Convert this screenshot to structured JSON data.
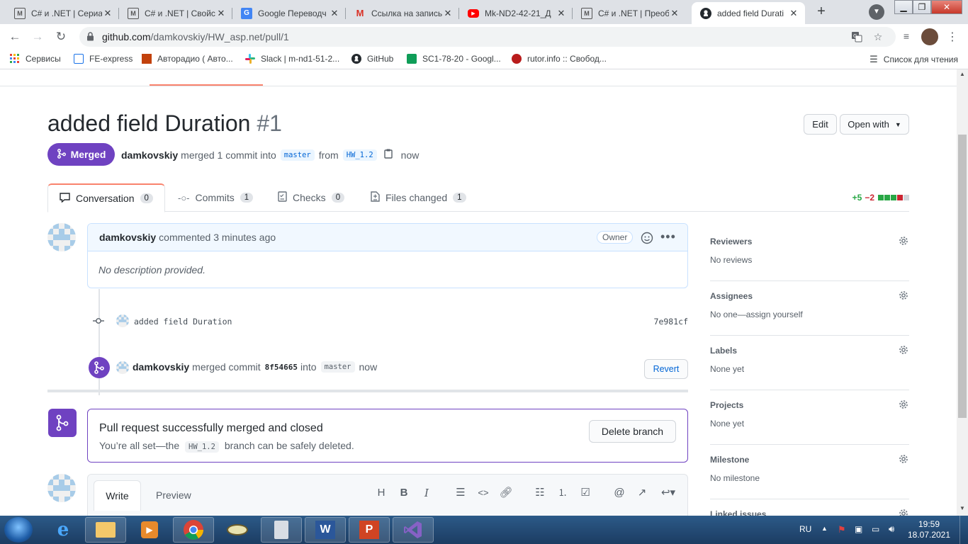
{
  "browser": {
    "tabs": [
      {
        "title": "C# и .NET | Сериа",
        "icon": "metanit-icon"
      },
      {
        "title": "C# и .NET | Свойс",
        "icon": "metanit-icon"
      },
      {
        "title": "Google Переводч",
        "icon": "google-translate-icon"
      },
      {
        "title": "Ссылка на запись",
        "icon": "gmail-icon"
      },
      {
        "title": "Mk-ND2-42-21_Д",
        "icon": "youtube-icon"
      },
      {
        "title": "C# и .NET | Преоб",
        "icon": "metanit-icon"
      },
      {
        "title": "added field Durati",
        "icon": "github-icon",
        "active": true
      }
    ],
    "url_host": "github.com",
    "url_path": "/damkovskiy/HW_asp.net/pull/1",
    "bookmarks": [
      {
        "label": "Сервисы",
        "icon": "apps-grid-icon"
      },
      {
        "label": "FE-express",
        "icon": "bookmark-page-icon"
      },
      {
        "label": "Авторадио ( Авто...",
        "icon": "radio-icon"
      },
      {
        "label": "Slack | m-nd1-51-2...",
        "icon": "slack-icon"
      },
      {
        "label": "GitHub",
        "icon": "github-icon"
      },
      {
        "label": "SC1-78-20 - Googl...",
        "icon": "sheets-icon"
      },
      {
        "label": "rutor.info :: Свобод...",
        "icon": "rutor-icon"
      }
    ],
    "reading_list": "Список для чтения"
  },
  "pr": {
    "title": "added field Duration",
    "number": "#1",
    "edit_label": "Edit",
    "open_with_label": "Open with",
    "state": "Merged",
    "author": "damkovskiy",
    "meta_merged": "merged 1 commit into",
    "base_branch": "master",
    "meta_from": "from",
    "head_branch": "HW_1.2",
    "meta_time": "now",
    "tabs": [
      {
        "label": "Conversation",
        "count": "0"
      },
      {
        "label": "Commits",
        "count": "1"
      },
      {
        "label": "Checks",
        "count": "0"
      },
      {
        "label": "Files changed",
        "count": "1"
      }
    ],
    "additions": "+5",
    "deletions": "−2"
  },
  "comment": {
    "author": "damkovskiy",
    "action": "commented 3 minutes ago",
    "role": "Owner",
    "body": "No description provided."
  },
  "commit": {
    "message": "added field Duration",
    "sha": "7e981cf"
  },
  "merge_event": {
    "author": "damkovskiy",
    "text_before": "merged commit",
    "sha": "8f54665",
    "text_into": "into",
    "branch": "master",
    "time": "now",
    "revert_label": "Revert"
  },
  "merged_box": {
    "title": "Pull request successfully merged and closed",
    "sub_before": "You’re all set—the",
    "branch": "HW_1.2",
    "sub_after": "branch can be safely deleted.",
    "delete_label": "Delete branch"
  },
  "editor": {
    "write_label": "Write",
    "preview_label": "Preview"
  },
  "sidebar": [
    {
      "heading": "Reviewers",
      "value": "No reviews"
    },
    {
      "heading": "Assignees",
      "value": "No one—assign yourself"
    },
    {
      "heading": "Labels",
      "value": "None yet"
    },
    {
      "heading": "Projects",
      "value": "None yet"
    },
    {
      "heading": "Milestone",
      "value": "No milestone"
    },
    {
      "heading": "Linked issues",
      "value": ""
    }
  ],
  "taskbar": {
    "lang": "RU",
    "time": "19:59",
    "date": "18.07.2021"
  },
  "colors": {
    "merged": "#6f42c1",
    "accent_tab": "#f9826c",
    "link": "#0366d6",
    "add": "#28a745",
    "del": "#cb2431"
  }
}
